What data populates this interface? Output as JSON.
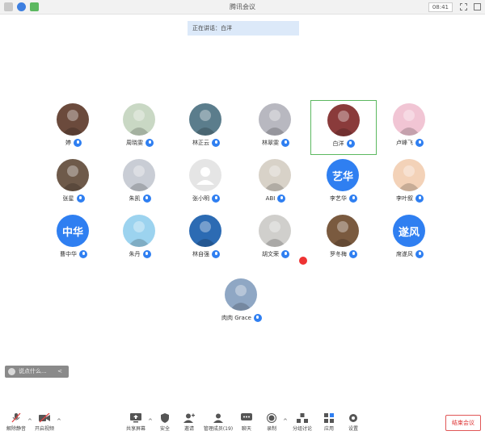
{
  "window": {
    "title": "腾讯会议",
    "time": "08:41"
  },
  "talking": "正在讲话：白洋",
  "participants": [
    {
      "name": "婷",
      "avatar_color": "#6b4a3c",
      "muted": false
    },
    {
      "name": "周晓雯",
      "avatar_color": "#c9d8c4",
      "muted": false
    },
    {
      "name": "林正云",
      "avatar_color": "#5b7d8c",
      "muted": false
    },
    {
      "name": "林翠雯",
      "avatar_color": "#b8b8c0",
      "muted": false
    },
    {
      "name": "白洋",
      "avatar_color": "#8a3b3b",
      "muted": false,
      "active": true
    },
    {
      "name": "卢峰飞",
      "avatar_color": "#f1c5d4",
      "muted": false
    },
    {
      "name": "张星",
      "avatar_color": "#6e5a4a",
      "muted": false
    },
    {
      "name": "朱凯",
      "avatar_color": "#c9cdd5",
      "muted": false
    },
    {
      "name": "张小明",
      "avatar_color": "#e5e5e5",
      "muted": false,
      "default_avatar": true
    },
    {
      "name": "ABI",
      "avatar_color": "#d8d2c8",
      "muted": false
    },
    {
      "name": "李艺华",
      "avatar_color": "#2f7ff1",
      "avatar_text": "艺华",
      "muted": false
    },
    {
      "name": "李叶叙",
      "avatar_color": "#f3d2b8",
      "muted": false
    },
    {
      "name": "曹中华",
      "avatar_color": "#2f7ff1",
      "avatar_text": "中华",
      "muted": false
    },
    {
      "name": "朱丹",
      "avatar_color": "#9cd3ef",
      "muted": false
    },
    {
      "name": "林自强",
      "avatar_color": "#2c6bb3",
      "muted": false
    },
    {
      "name": "胡文荣",
      "avatar_color": "#d0cfcc",
      "muted": true
    },
    {
      "name": "罗冬梅",
      "avatar_color": "#7a5a3f",
      "muted": false
    },
    {
      "name": "席遂风",
      "avatar_color": "#2f7ff1",
      "avatar_text": "遂风",
      "muted": false
    },
    {
      "name": "肉肉 Grace",
      "avatar_color": "#8fa7c4",
      "muted": false
    }
  ],
  "chat_pill": {
    "label": "说点什么...",
    "collapse": "<"
  },
  "toolbar": {
    "mute": "解除静音",
    "video": "开启视频",
    "share": "共享屏幕",
    "security": "安全",
    "invite": "邀请",
    "members": "管理成员(19)",
    "chat": "聊天",
    "record": "录制",
    "breakout": "分组讨论",
    "apps": "应用",
    "settings": "设置",
    "end": "结束会议"
  },
  "colors": {
    "accent": "#2f7ff1",
    "active_border": "#5cb860",
    "end": "#d33333"
  }
}
